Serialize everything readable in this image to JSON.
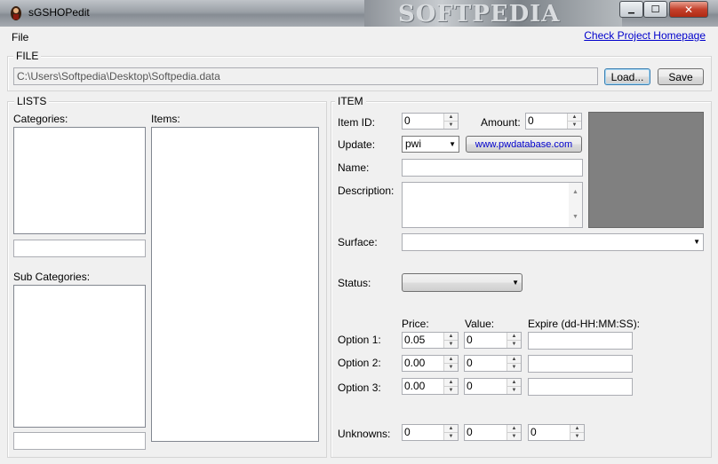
{
  "window": {
    "title": "sGSHOPedit",
    "banner_text": "SOFTPEDIA",
    "controls": {
      "minimize": "▁",
      "maximize": "☐",
      "close": "✕"
    }
  },
  "menubar": {
    "file_label": "File",
    "homepage_link": "Check Project Homepage"
  },
  "file_group": {
    "title": "FILE",
    "path_value": "C:\\Users\\Softpedia\\Desktop\\Softpedia.data",
    "load_label": "Load...",
    "save_label": "Save"
  },
  "lists_group": {
    "title": "LISTS",
    "categories_label": "Categories:",
    "items_label": "Items:",
    "sub_categories_label": "Sub Categories:"
  },
  "item_group": {
    "title": "ITEM",
    "item_id_label": "Item ID:",
    "item_id_value": "0",
    "amount_label": "Amount:",
    "amount_value": "0",
    "update_label": "Update:",
    "update_value": "pwi",
    "pwdatabase_button": "www.pwdatabase.com",
    "name_label": "Name:",
    "description_label": "Description:",
    "surface_label": "Surface:",
    "status_label": "Status:",
    "price_header": "Price:",
    "value_header": "Value:",
    "expire_header": "Expire (dd-HH:MM:SS):",
    "options": [
      {
        "label": "Option 1:",
        "price": "0.05",
        "value": "0"
      },
      {
        "label": "Option 2:",
        "price": "0.00",
        "value": "0"
      },
      {
        "label": "Option 3:",
        "price": "0.00",
        "value": "0"
      }
    ],
    "unknowns_label": "Unknowns:",
    "unknowns": [
      "0",
      "0",
      "0"
    ]
  },
  "colors": {
    "link": "#0000cc",
    "pwdatabase_text": "#0000cc",
    "preview_box": "#808080"
  }
}
